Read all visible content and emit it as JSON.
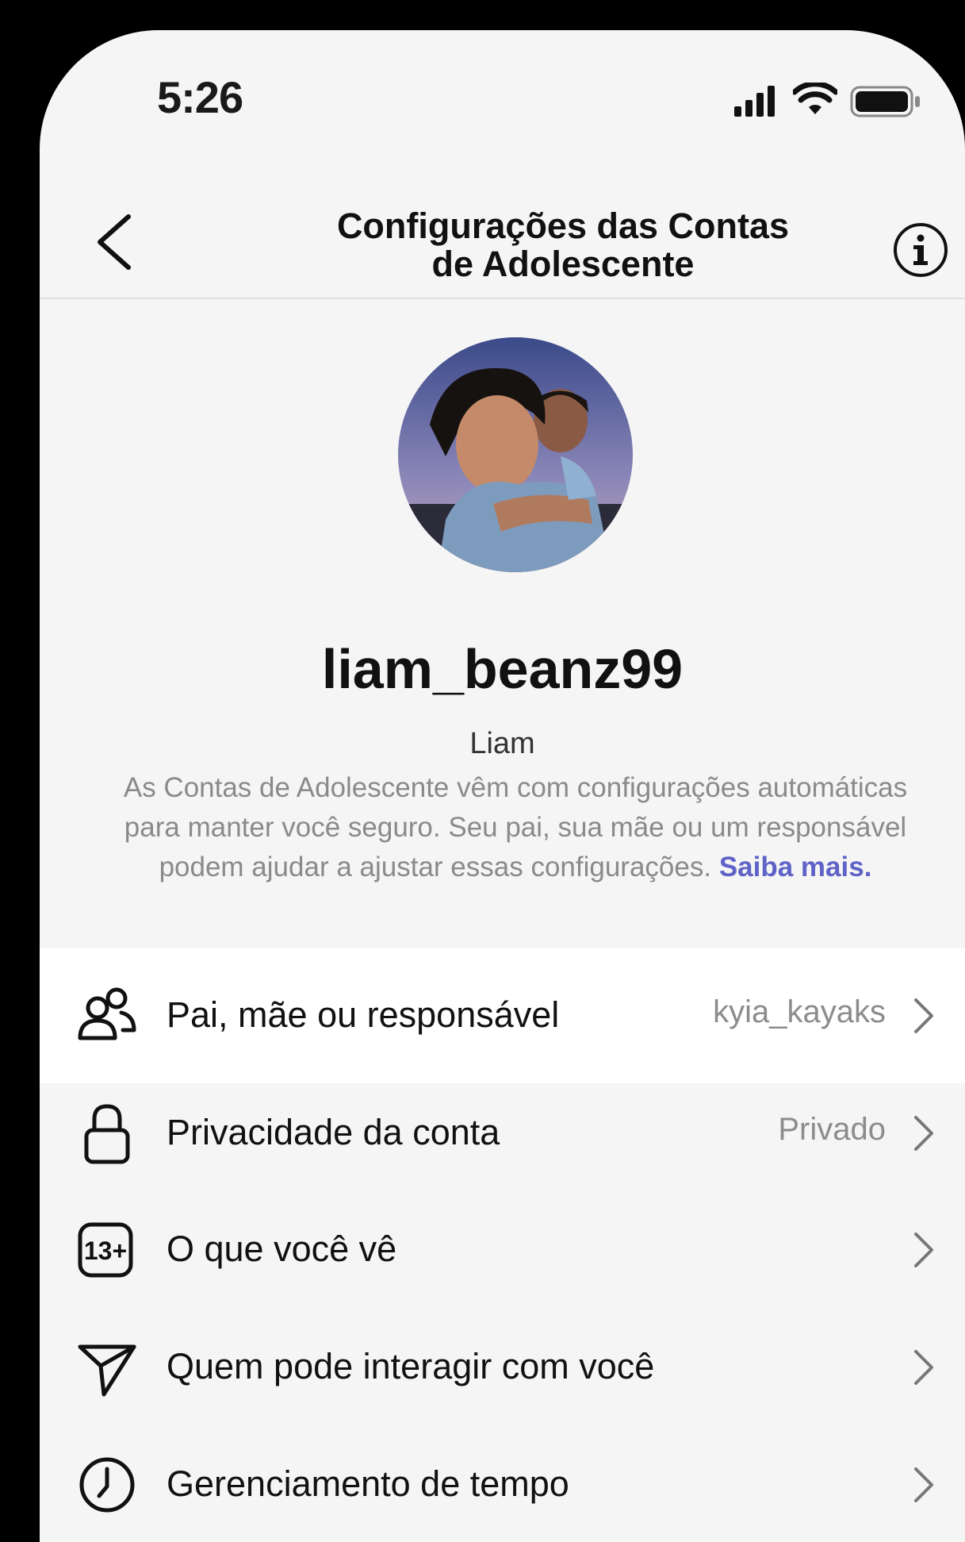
{
  "status_bar": {
    "time": "5:26"
  },
  "header": {
    "title_line1": "Configurações das Contas",
    "title_line2": "de Adolescente"
  },
  "profile": {
    "username": "liam_beanz99",
    "display_name": "Liam",
    "description": "As Contas de Adolescente vêm com configurações automáticas para manter você seguro. Seu pai, sua mãe ou um responsável podem ajudar a ajustar essas configurações.",
    "learn_more": "Saiba mais."
  },
  "settings": {
    "items": [
      {
        "label": "Pai, mãe ou responsável",
        "value": "kyia_kayaks",
        "icon": "people-icon"
      },
      {
        "label": "Privacidade da conta",
        "value": "Privado",
        "icon": "lock-icon"
      },
      {
        "label": "O que você vê",
        "value": "",
        "icon": "age-13-plus-icon"
      },
      {
        "label": "Quem pode interagir com você",
        "value": "",
        "icon": "send-icon"
      },
      {
        "label": "Gerenciamento de tempo",
        "value": "",
        "icon": "clock-icon"
      }
    ]
  },
  "colors": {
    "accent_link": "#5f63c8",
    "background": "#f5f5f5",
    "highlight_row": "#ffffff"
  }
}
